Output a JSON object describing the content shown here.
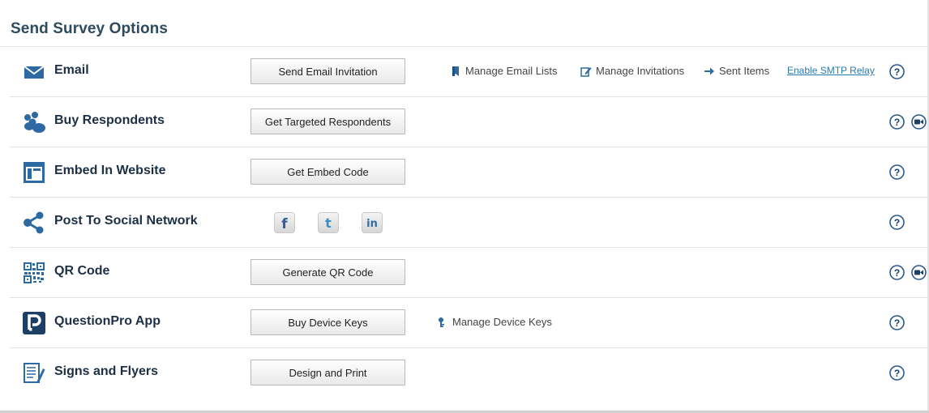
{
  "page_title": "Send Survey Options",
  "colors": {
    "icon_blue": "#2d6aa3",
    "title": "#2d4a5f",
    "label": "#1c2f44",
    "link": "#2a7bb0"
  },
  "rows": [
    {
      "label": "Email",
      "icon": "envelope-icon",
      "button": "Send Email Invitation",
      "links": [
        {
          "label": "Manage Email Lists",
          "icon": "bookmark-icon"
        },
        {
          "label": "Manage Invitations",
          "icon": "edit-icon"
        },
        {
          "label": "Sent Items",
          "icon": "arrow-right-icon"
        }
      ],
      "smtp_link": "Enable SMTP Relay",
      "help": "?",
      "has_video": false
    },
    {
      "label": "Buy Respondents",
      "icon": "people-icon",
      "button": "Get Targeted Respondents",
      "help": "?",
      "has_video": true
    },
    {
      "label": "Embed In Website",
      "icon": "webpage-icon",
      "button": "Get Embed Code",
      "help": "?",
      "has_video": false
    },
    {
      "label": "Post To Social Network",
      "icon": "share-icon",
      "social": [
        {
          "name": "facebook",
          "glyph": "f"
        },
        {
          "name": "twitter",
          "glyph": "t"
        },
        {
          "name": "linkedin",
          "glyph": "in"
        }
      ],
      "help": "?",
      "has_video": false
    },
    {
      "label": "QR Code",
      "icon": "qr-code-icon",
      "button": "Generate QR Code",
      "help": "?",
      "has_video": true
    },
    {
      "label": "QuestionPro App",
      "icon": "questionpro-app-icon",
      "button": "Buy Device Keys",
      "links": [
        {
          "label": "Manage Device Keys",
          "icon": "key-icon"
        }
      ],
      "help": "?",
      "has_video": false
    },
    {
      "label": "Signs and Flyers",
      "icon": "flyer-icon",
      "button": "Design and Print",
      "help": "?",
      "has_video": false
    }
  ]
}
